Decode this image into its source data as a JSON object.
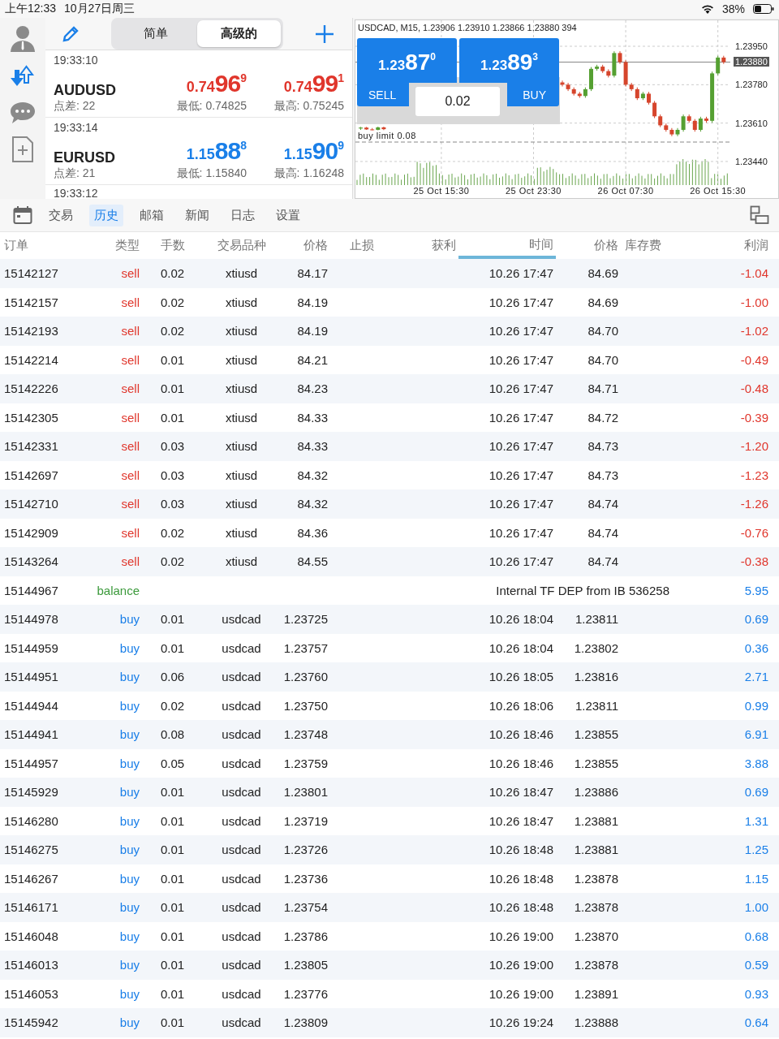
{
  "status_bar": {
    "time": "上午12:33",
    "date": "10月27日周三",
    "battery": "38%"
  },
  "mode_switch": [
    {
      "label": "简单",
      "selected": false
    },
    {
      "label": "高级的",
      "selected": true
    }
  ],
  "quotes": [
    {
      "time": "19:33:10",
      "symbol": "AUDUSD",
      "spread": "点差: 22",
      "color": "#e0362c",
      "bid": {
        "prefix": "0.74",
        "big": "96",
        "sup": "9"
      },
      "ask": {
        "prefix": "0.74",
        "big": "99",
        "sup": "1"
      },
      "low": "最低: 0.74825",
      "high": "最高: 0.75245"
    },
    {
      "time": "19:33:14",
      "symbol": "EURUSD",
      "spread": "点差: 21",
      "color": "#1a7fe8",
      "bid": {
        "prefix": "1.15",
        "big": "88",
        "sup": "8"
      },
      "ask": {
        "prefix": "1.15",
        "big": "90",
        "sup": "9"
      },
      "low": "最低: 1.15840",
      "high": "最高: 1.16248"
    },
    {
      "time": "19:33:12"
    }
  ],
  "chart": {
    "title": "USDCAD, M15, 1.23906 1.23910 1.23866 1.23880 394",
    "chart_data": {
      "type": "candlestick",
      "categories": [
        null,
        null,
        null,
        null,
        null,
        null,
        null,
        null,
        null,
        null,
        null,
        null,
        null,
        null,
        "25 Oct 15:30",
        null,
        null,
        null,
        null,
        null,
        null,
        null,
        null,
        null,
        null,
        null,
        null,
        null,
        null,
        null,
        "25 Oct 23:30",
        null,
        null,
        null,
        null,
        null,
        null,
        null,
        null,
        null,
        null,
        null,
        null,
        null,
        null,
        null,
        "26 Oct 07:30",
        null,
        null,
        null,
        null,
        null,
        null,
        null,
        null,
        null,
        null,
        null,
        null,
        null,
        null,
        null,
        "26 Oct 15:30",
        null
      ],
      "grid": true,
      "ref_lines": [
        {
          "axis": "y",
          "value": 1.2388,
          "label": "1.23880"
        },
        {
          "axis": "y",
          "value": 1.23526,
          "label": "buy limit 0.08"
        }
      ],
      "ohlc": [
        [
          1.23586,
          1.23593,
          1.2358,
          1.2359
        ],
        [
          1.2359,
          1.23593,
          1.2358,
          1.23582
        ],
        [
          1.23582,
          1.23588,
          1.23578,
          1.2358
        ],
        [
          1.2358,
          1.23594,
          1.23578,
          1.23591
        ],
        [
          1.23591,
          1.23594,
          1.23579,
          1.23583
        ],
        null,
        null,
        null,
        null,
        null,
        null,
        null,
        null,
        null,
        null,
        null,
        null,
        null,
        null,
        null,
        null,
        null,
        null,
        null,
        null,
        null,
        null,
        null,
        null,
        null,
        null,
        null,
        null,
        null,
        null,
        [
          1.2379,
          1.23798,
          1.23772,
          1.2378
        ],
        [
          1.2378,
          1.23788,
          1.23752,
          1.2376
        ],
        [
          1.2376,
          1.23768,
          1.23732,
          1.2374
        ],
        [
          1.2374,
          1.23748,
          1.23722,
          1.2373
        ],
        [
          1.2373,
          1.23768,
          1.23722,
          1.2376
        ],
        [
          1.2376,
          1.23858,
          1.23752,
          1.2385
        ],
        [
          1.2385,
          1.23868,
          1.23842,
          1.2386
        ],
        [
          1.2386,
          1.23868,
          1.23832,
          1.2384
        ],
        [
          1.2384,
          1.23848,
          1.23812,
          1.2382
        ],
        [
          1.2382,
          1.23928,
          1.23812,
          1.2392
        ],
        [
          1.2392,
          1.23928,
          1.23872,
          1.2388
        ],
        [
          1.2388,
          1.23888,
          1.23772,
          1.2378
        ],
        [
          1.2378,
          1.23788,
          1.23752,
          1.2376
        ],
        [
          1.2376,
          1.23768,
          1.23712,
          1.2372
        ],
        [
          1.2372,
          1.23748,
          1.23712,
          1.2374
        ],
        [
          1.2374,
          1.23748,
          1.23692,
          1.237
        ],
        [
          1.237,
          1.23708,
          1.23632,
          1.2364
        ],
        [
          1.2364,
          1.23648,
          1.23592,
          1.236
        ],
        [
          1.236,
          1.23608,
          1.23572,
          1.2358
        ],
        [
          1.2358,
          1.23588,
          1.23552,
          1.2356
        ],
        [
          1.2356,
          1.23588,
          1.23552,
          1.2358
        ],
        [
          1.2358,
          1.23648,
          1.23572,
          1.2364
        ],
        [
          1.2364,
          1.23648,
          1.23612,
          1.2362
        ],
        [
          1.2362,
          1.23628,
          1.23572,
          1.2358
        ],
        [
          1.2358,
          1.23638,
          1.23572,
          1.2363
        ],
        [
          1.2363,
          1.23638,
          1.23612,
          1.2362
        ],
        [
          1.2362,
          1.23838,
          1.23612,
          1.2383
        ],
        [
          1.2383,
          1.23908,
          1.23822,
          1.239
        ],
        [
          1.239,
          1.23908,
          1.23872,
          1.2388
        ]
      ],
      "ylim": [
        1.23332,
        1.24065
      ],
      "yticks": [
        {
          "value": 1.2395,
          "label": "1.23950"
        },
        {
          "value": 1.2378,
          "label": "1.23780"
        },
        {
          "value": 1.2361,
          "label": "1.23610"
        },
        {
          "value": 1.2344,
          "label": "1.23440"
        }
      ]
    },
    "trade_panel": {
      "sell": {
        "prefix": "1.23",
        "big": "87",
        "sup": "0",
        "label": "SELL"
      },
      "buy": {
        "prefix": "1.23",
        "big": "89",
        "sup": "3",
        "label": "BUY"
      },
      "volume": "0.02"
    }
  },
  "tabs": [
    {
      "label": "交易",
      "selected": false
    },
    {
      "label": "历史",
      "selected": true
    },
    {
      "label": "邮箱",
      "selected": false
    },
    {
      "label": "新闻",
      "selected": false
    },
    {
      "label": "日志",
      "selected": false
    },
    {
      "label": "设置",
      "selected": false
    }
  ],
  "table": {
    "columns": [
      {
        "label": "订单",
        "sorted": false
      },
      {
        "label": "类型",
        "sorted": false
      },
      {
        "label": "手数",
        "sorted": false
      },
      {
        "label": "交易品种",
        "sorted": false
      },
      {
        "label": "价格",
        "sorted": false
      },
      {
        "label": "止损",
        "sorted": false
      },
      {
        "label": "获利",
        "sorted": false
      },
      {
        "label": "时间",
        "sorted": true
      },
      {
        "label": "价格",
        "sorted": false
      },
      {
        "label": "库存费",
        "sorted": false
      },
      {
        "label": "利润",
        "sorted": false
      }
    ],
    "rows": [
      {
        "kind": "sell",
        "order": "15142127",
        "type": "sell",
        "lots": "0.02",
        "symbol": "xtiusd",
        "price": "84.17",
        "time": "10.26 17:47",
        "close_price": "84.69",
        "profit": "-1.04",
        "loss": true
      },
      {
        "kind": "sell",
        "order": "15142157",
        "type": "sell",
        "lots": "0.02",
        "symbol": "xtiusd",
        "price": "84.19",
        "time": "10.26 17:47",
        "close_price": "84.69",
        "profit": "-1.00",
        "loss": true
      },
      {
        "kind": "sell",
        "order": "15142193",
        "type": "sell",
        "lots": "0.02",
        "symbol": "xtiusd",
        "price": "84.19",
        "time": "10.26 17:47",
        "close_price": "84.70",
        "profit": "-1.02",
        "loss": true
      },
      {
        "kind": "sell",
        "order": "15142214",
        "type": "sell",
        "lots": "0.01",
        "symbol": "xtiusd",
        "price": "84.21",
        "time": "10.26 17:47",
        "close_price": "84.70",
        "profit": "-0.49",
        "loss": true
      },
      {
        "kind": "sell",
        "order": "15142226",
        "type": "sell",
        "lots": "0.01",
        "symbol": "xtiusd",
        "price": "84.23",
        "time": "10.26 17:47",
        "close_price": "84.71",
        "profit": "-0.48",
        "loss": true
      },
      {
        "kind": "sell",
        "order": "15142305",
        "type": "sell",
        "lots": "0.01",
        "symbol": "xtiusd",
        "price": "84.33",
        "time": "10.26 17:47",
        "close_price": "84.72",
        "profit": "-0.39",
        "loss": true
      },
      {
        "kind": "sell",
        "order": "15142331",
        "type": "sell",
        "lots": "0.03",
        "symbol": "xtiusd",
        "price": "84.33",
        "time": "10.26 17:47",
        "close_price": "84.73",
        "profit": "-1.20",
        "loss": true
      },
      {
        "kind": "sell",
        "order": "15142697",
        "type": "sell",
        "lots": "0.03",
        "symbol": "xtiusd",
        "price": "84.32",
        "time": "10.26 17:47",
        "close_price": "84.73",
        "profit": "-1.23",
        "loss": true
      },
      {
        "kind": "sell",
        "order": "15142710",
        "type": "sell",
        "lots": "0.03",
        "symbol": "xtiusd",
        "price": "84.32",
        "time": "10.26 17:47",
        "close_price": "84.74",
        "profit": "-1.26",
        "loss": true
      },
      {
        "kind": "sell",
        "order": "15142909",
        "type": "sell",
        "lots": "0.02",
        "symbol": "xtiusd",
        "price": "84.36",
        "time": "10.26 17:47",
        "close_price": "84.74",
        "profit": "-0.76",
        "loss": true
      },
      {
        "kind": "sell",
        "order": "15143264",
        "type": "sell",
        "lots": "0.02",
        "symbol": "xtiusd",
        "price": "84.55",
        "time": "10.26 17:47",
        "close_price": "84.74",
        "profit": "-0.38",
        "loss": true
      },
      {
        "kind": "balance",
        "order": "15144967",
        "type": "balance",
        "comment": "Internal TF DEP from IB 536258",
        "profit": "5.95",
        "loss": false
      },
      {
        "kind": "buy",
        "order": "15144978",
        "type": "buy",
        "lots": "0.01",
        "symbol": "usdcad",
        "price": "1.23725",
        "time": "10.26 18:04",
        "close_price": "1.23811",
        "profit": "0.69",
        "loss": false
      },
      {
        "kind": "buy",
        "order": "15144959",
        "type": "buy",
        "lots": "0.01",
        "symbol": "usdcad",
        "price": "1.23757",
        "time": "10.26 18:04",
        "close_price": "1.23802",
        "profit": "0.36",
        "loss": false
      },
      {
        "kind": "buy",
        "order": "15144951",
        "type": "buy",
        "lots": "0.06",
        "symbol": "usdcad",
        "price": "1.23760",
        "time": "10.26 18:05",
        "close_price": "1.23816",
        "profit": "2.71",
        "loss": false
      },
      {
        "kind": "buy",
        "order": "15144944",
        "type": "buy",
        "lots": "0.02",
        "symbol": "usdcad",
        "price": "1.23750",
        "time": "10.26 18:06",
        "close_price": "1.23811",
        "profit": "0.99",
        "loss": false
      },
      {
        "kind": "buy",
        "order": "15144941",
        "type": "buy",
        "lots": "0.08",
        "symbol": "usdcad",
        "price": "1.23748",
        "time": "10.26 18:46",
        "close_price": "1.23855",
        "profit": "6.91",
        "loss": false
      },
      {
        "kind": "buy",
        "order": "15144957",
        "type": "buy",
        "lots": "0.05",
        "symbol": "usdcad",
        "price": "1.23759",
        "time": "10.26 18:46",
        "close_price": "1.23855",
        "profit": "3.88",
        "loss": false
      },
      {
        "kind": "buy",
        "order": "15145929",
        "type": "buy",
        "lots": "0.01",
        "symbol": "usdcad",
        "price": "1.23801",
        "time": "10.26 18:47",
        "close_price": "1.23886",
        "profit": "0.69",
        "loss": false
      },
      {
        "kind": "buy",
        "order": "15146280",
        "type": "buy",
        "lots": "0.01",
        "symbol": "usdcad",
        "price": "1.23719",
        "time": "10.26 18:47",
        "close_price": "1.23881",
        "profit": "1.31",
        "loss": false
      },
      {
        "kind": "buy",
        "order": "15146275",
        "type": "buy",
        "lots": "0.01",
        "symbol": "usdcad",
        "price": "1.23726",
        "time": "10.26 18:48",
        "close_price": "1.23881",
        "profit": "1.25",
        "loss": false
      },
      {
        "kind": "buy",
        "order": "15146267",
        "type": "buy",
        "lots": "0.01",
        "symbol": "usdcad",
        "price": "1.23736",
        "time": "10.26 18:48",
        "close_price": "1.23878",
        "profit": "1.15",
        "loss": false
      },
      {
        "kind": "buy",
        "order": "15146171",
        "type": "buy",
        "lots": "0.01",
        "symbol": "usdcad",
        "price": "1.23754",
        "time": "10.26 18:48",
        "close_price": "1.23878",
        "profit": "1.00",
        "loss": false
      },
      {
        "kind": "buy",
        "order": "15146048",
        "type": "buy",
        "lots": "0.01",
        "symbol": "usdcad",
        "price": "1.23786",
        "time": "10.26 19:00",
        "close_price": "1.23870",
        "profit": "0.68",
        "loss": false
      },
      {
        "kind": "buy",
        "order": "15146013",
        "type": "buy",
        "lots": "0.01",
        "symbol": "usdcad",
        "price": "1.23805",
        "time": "10.26 19:00",
        "close_price": "1.23878",
        "profit": "0.59",
        "loss": false
      },
      {
        "kind": "buy",
        "order": "15146053",
        "type": "buy",
        "lots": "0.01",
        "symbol": "usdcad",
        "price": "1.23776",
        "time": "10.26 19:00",
        "close_price": "1.23891",
        "profit": "0.93",
        "loss": false
      },
      {
        "kind": "buy",
        "order": "15145942",
        "type": "buy",
        "lots": "0.01",
        "symbol": "usdcad",
        "price": "1.23809",
        "time": "10.26 19:24",
        "close_price": "1.23888",
        "profit": "0.64",
        "loss": false
      }
    ]
  }
}
